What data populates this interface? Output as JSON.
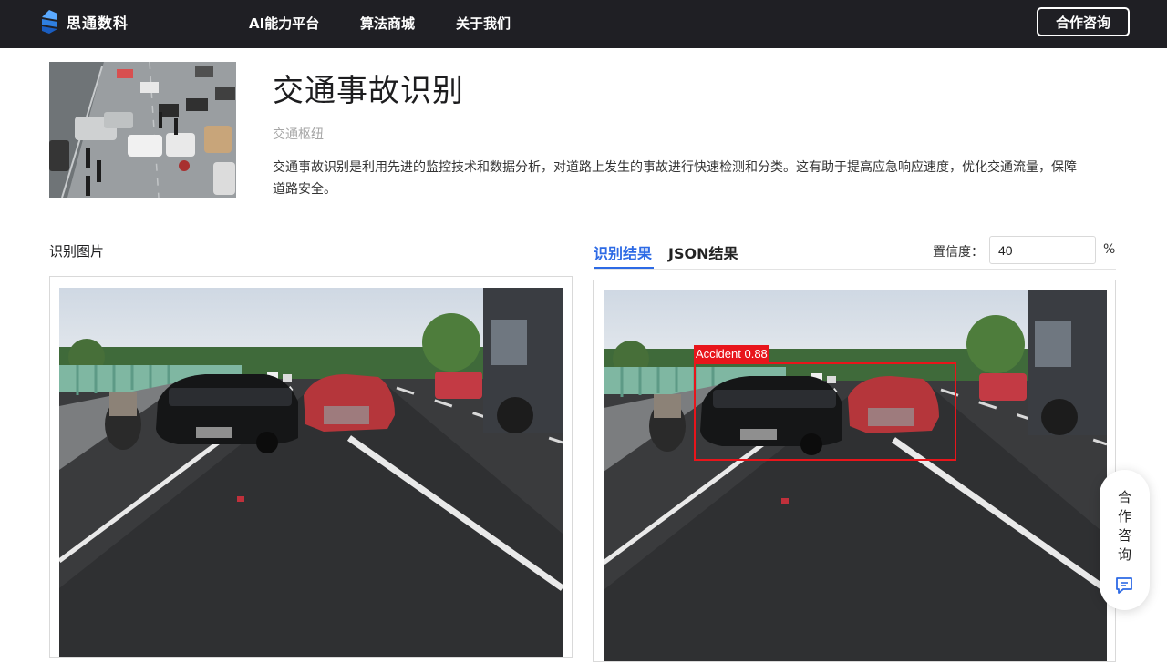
{
  "nav": {
    "logo_text": "思通数科",
    "links": [
      "AI能力平台",
      "算法商城",
      "关于我们"
    ],
    "cta": "合作咨询"
  },
  "header": {
    "title": "交通事故识别",
    "subtitle": "交通枢纽",
    "description": "交通事故识别是利用先进的监控技术和数据分析，对道路上发生的事故进行快速检测和分类。这有助于提高应急响应速度，优化交通流量，保障道路安全。"
  },
  "left_panel": {
    "label": "识别图片"
  },
  "right_panel": {
    "tabs": [
      "识别结果",
      "JSON结果"
    ],
    "active_tab": 0,
    "confidence_label": "置信度：",
    "confidence_value": "40",
    "confidence_unit": "%",
    "detection": {
      "label": "Accident 0.88",
      "class": "Accident",
      "score": 0.88,
      "color": "#e8151b"
    }
  },
  "floating": {
    "label": "合作咨询",
    "icon": "chat-icon"
  },
  "colors": {
    "nav_bg": "#1f1f24",
    "accent": "#2d6ae5",
    "bbox": "#e8151b"
  }
}
